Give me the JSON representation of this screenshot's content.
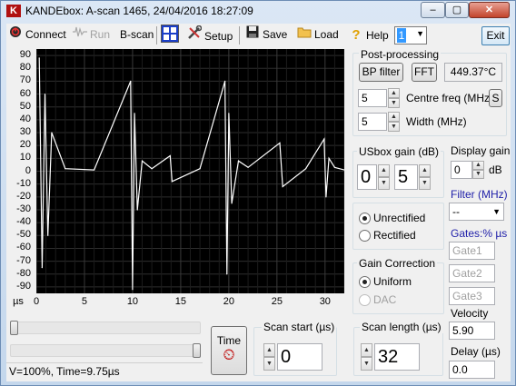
{
  "window": {
    "logo": "K",
    "title": "KANDEbox: A-scan 1465, 24/04/2016 18:27:09",
    "min": "–",
    "max": "▢",
    "close": "✕"
  },
  "toolbar": {
    "connect": "Connect",
    "run": "Run",
    "bscan": "B-scan",
    "setup": "Setup",
    "save": "Save",
    "load": "Load",
    "help": "Help",
    "channel": "1",
    "exit": "Exit"
  },
  "plot": {
    "yticks": [
      "90",
      "80",
      "70",
      "60",
      "50",
      "40",
      "30",
      "20",
      "10",
      "0",
      "-10",
      "-20",
      "-30",
      "-40",
      "-50",
      "-60",
      "-70",
      "-80",
      "-90"
    ],
    "xunit": "µs",
    "xticks": [
      "0",
      "5",
      "10",
      "15",
      "20",
      "25",
      "30"
    ]
  },
  "chart_data": {
    "type": "line",
    "title": "",
    "xlabel": "µs",
    "ylabel": "",
    "xlim": [
      0,
      32
    ],
    "ylim": [
      -95,
      95
    ],
    "grid": true,
    "series": [
      {
        "values_desc": "",
        "x": [
          0.3,
          0.6,
          0.9,
          1.2,
          1.6,
          3,
          6,
          9.8,
          10.0,
          10.2,
          10.5,
          11,
          12,
          13.9,
          14.1,
          17,
          19.6,
          19.8,
          20.0,
          20.3,
          21,
          22,
          25.3,
          25.6,
          28,
          29.9,
          30.1,
          30.4,
          31,
          32
        ],
        "y": [
          88,
          -75,
          60,
          -50,
          30,
          2,
          1,
          70,
          -92,
          45,
          -30,
          8,
          2,
          12,
          -8,
          2,
          70,
          -80,
          45,
          -25,
          8,
          3,
          22,
          -12,
          2,
          25,
          -20,
          10,
          3,
          1
        ]
      }
    ],
    "trace_color": "#ffffff"
  },
  "post": {
    "label": "Post-processing",
    "bp_filter": "BP filter",
    "fft": "FFT",
    "temp": "449.37°C",
    "centre_val": "5",
    "centre_label": "Centre freq (MHz)",
    "s_btn": "S",
    "width_val": "5",
    "width_label": "Width (MHz)"
  },
  "usbox": {
    "label": "USbox gain (dB)",
    "v1": "0",
    "v2": "5"
  },
  "display_gain": {
    "label": "Display gain",
    "val": "0",
    "unit": "dB"
  },
  "filter": {
    "label": "Filter (MHz)",
    "value": "--"
  },
  "gates": {
    "label": "Gates:% µs",
    "g1": "Gate1",
    "g2": "Gate2",
    "g3": "Gate3"
  },
  "rect": {
    "unrectified": "Unrectified",
    "rectified": "Rectified"
  },
  "gain_corr": {
    "label": "Gain Correction",
    "uniform": "Uniform",
    "dac": "DAC"
  },
  "sliders": {
    "top": 0.0,
    "bottom": 1.0
  },
  "status": "V=100%, Time=9.75µs",
  "time_btn": {
    "label": "Time",
    "icon": "⏲"
  },
  "scan_start": {
    "label": "Scan start (µs)",
    "val": "0"
  },
  "scan_length": {
    "label": "Scan length (µs)",
    "val": "32"
  },
  "velocity": {
    "label": "Velocity",
    "val": "5.90"
  },
  "delay": {
    "label": "Delay (µs)",
    "val": "0.0"
  },
  "icons": {
    "connect": "power-icon",
    "run": "waveform-icon",
    "bscan": "grid-icon",
    "setup": "tools-icon",
    "save": "floppy-icon",
    "load": "folder-icon",
    "help": "question-icon"
  }
}
